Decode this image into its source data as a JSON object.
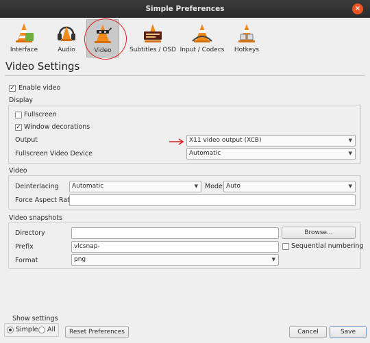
{
  "window": {
    "title": "Simple Preferences",
    "close_icon": "×"
  },
  "toolbar": {
    "items": [
      {
        "label": "Interface"
      },
      {
        "label": "Audio"
      },
      {
        "label": "Video"
      },
      {
        "label": "Subtitles / OSD"
      },
      {
        "label": "Input / Codecs"
      },
      {
        "label": "Hotkeys"
      }
    ],
    "active_item": "Video"
  },
  "page": {
    "title": "Video Settings"
  },
  "enable_video": {
    "label": "Enable video",
    "checked": true,
    "check_mark": "✓"
  },
  "display": {
    "section_label": "Display",
    "fullscreen": {
      "label": "Fullscreen",
      "checked": false
    },
    "window_decorations": {
      "label": "Window decorations",
      "checked": true,
      "check_mark": "✓"
    },
    "output": {
      "label": "Output",
      "value": "X11 video output (XCB)"
    },
    "fullscreen_device": {
      "label": "Fullscreen Video Device",
      "value": "Automatic"
    }
  },
  "video": {
    "section_label": "Video",
    "deinterlacing": {
      "label": "Deinterlacing",
      "value": "Automatic"
    },
    "mode": {
      "label": "Mode",
      "value": "Auto"
    },
    "force_aspect_ratio": {
      "label": "Force Aspect Ratio",
      "value": ""
    }
  },
  "snapshots": {
    "section_label": "Video snapshots",
    "directory": {
      "label": "Directory",
      "value": ""
    },
    "browse_button": "Browse...",
    "prefix": {
      "label": "Prefix",
      "value": "vlcsnap-"
    },
    "sequential_numbering": {
      "label": "Sequential numbering",
      "checked": false
    },
    "format": {
      "label": "Format",
      "value": "png"
    }
  },
  "footer": {
    "show_settings": "Show settings",
    "simple": "Simple",
    "all": "All",
    "selected": "Simple",
    "reset_button": "Reset Preferences",
    "cancel_button": "Cancel",
    "save_button": "Save"
  },
  "colors": {
    "annotation_red": "#e01b1b",
    "titlebar": "#2c2c2c",
    "close_button": "#e95420"
  },
  "icons": [
    "close-icon",
    "vlc-cone-icon",
    "headphones-icon",
    "video-cone-icon",
    "subtitles-icon",
    "codecs-icon",
    "hotkeys-icon",
    "check-icon",
    "dropdown-arrow-icon"
  ]
}
